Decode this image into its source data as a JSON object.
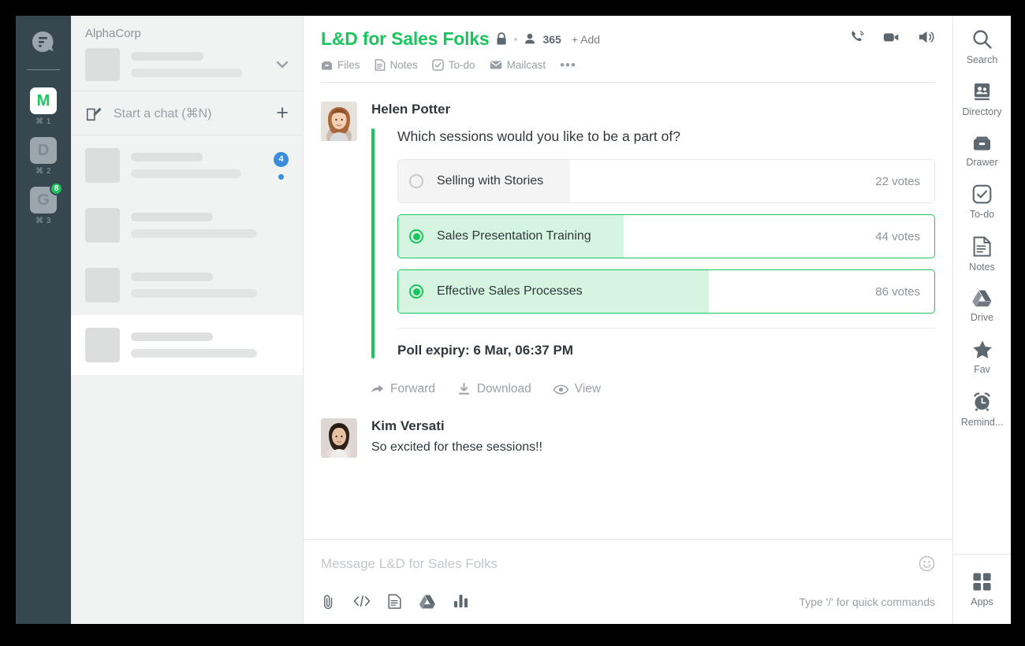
{
  "colors": {
    "accent_green": "#1ac55d",
    "rail_bg": "#36474f",
    "sidebar_bg": "#f1f2f2",
    "badge_blue": "#3a8ddb",
    "poll_fill_selected": "#d6f5e0",
    "poll_fill_unselected": "#f4f4f4",
    "text_dark": "#31383d",
    "text_muted": "#9aa0a5"
  },
  "rail": {
    "logo_icon": "flock-logo-icon",
    "orgs": [
      {
        "letter": "M",
        "shortcut": "⌘ 1",
        "active": true,
        "badge": ""
      },
      {
        "letter": "D",
        "shortcut": "⌘ 2",
        "active": false,
        "badge": ""
      },
      {
        "letter": "G",
        "shortcut": "⌘ 3",
        "active": false,
        "badge": "8"
      }
    ]
  },
  "sidebar": {
    "workspace_name": "AlphaCorp",
    "caret_icon": "chevron-down-icon",
    "start_chat_label": "Start a chat (⌘N)",
    "start_chat_icon": "compose-icon",
    "add_icon": "plus-icon",
    "chat_rows": [
      {
        "unread": "4",
        "has_dot": true,
        "highlight": false
      },
      {
        "unread": "",
        "has_dot": false,
        "highlight": false
      },
      {
        "unread": "",
        "has_dot": false,
        "highlight": false
      },
      {
        "unread": "",
        "has_dot": false,
        "highlight": true
      }
    ]
  },
  "header": {
    "channel_title": "L&D for Sales Folks",
    "lock_icon": "lock-icon",
    "members_icon": "person-icon",
    "member_count": "365",
    "add_label": "+ Add",
    "tabs": [
      {
        "label": "Files",
        "icon": "files-icon"
      },
      {
        "label": "Notes",
        "icon": "notes-icon"
      },
      {
        "label": "To-do",
        "icon": "todo-check-icon"
      },
      {
        "label": "Mailcast",
        "icon": "mail-icon"
      }
    ],
    "overflow_label": "•••",
    "actions": [
      {
        "name": "audio-call-icon"
      },
      {
        "name": "video-call-icon"
      },
      {
        "name": "announcement-icon"
      }
    ]
  },
  "messages": [
    {
      "author": "Helen Potter",
      "avatar": "helen-potter-avatar",
      "type": "poll",
      "poll": {
        "question": "Which sessions would you like to be a part of?",
        "options": [
          {
            "label": "Selling with Stories",
            "votes": "22 votes",
            "selected": false,
            "fill_pct": 32
          },
          {
            "label": "Sales Presentation Training",
            "votes": "44 votes",
            "selected": true,
            "fill_pct": 42
          },
          {
            "label": "Effective Sales Processes",
            "votes": "86 votes",
            "selected": true,
            "fill_pct": 58
          }
        ],
        "expiry": "Poll expiry: 6 Mar, 06:37 PM"
      },
      "actions": [
        {
          "label": "Forward",
          "icon": "forward-arrow-icon"
        },
        {
          "label": "Download",
          "icon": "download-icon"
        },
        {
          "label": "View",
          "icon": "eye-icon"
        }
      ]
    },
    {
      "author": "Kim Versati",
      "avatar": "kim-versati-avatar",
      "type": "text",
      "text": "So excited for these sessions!!"
    }
  ],
  "composer": {
    "placeholder": "Message L&D for Sales Folks",
    "emoji_icon": "smiley-icon",
    "hint": "Type '/' for quick commands",
    "icons": [
      {
        "name": "attachment-icon"
      },
      {
        "name": "code-snippet-icon"
      },
      {
        "name": "document-icon"
      },
      {
        "name": "google-drive-icon"
      },
      {
        "name": "poll-chart-icon"
      }
    ]
  },
  "rightbar": {
    "items": [
      {
        "label": "Search",
        "icon": "search-icon"
      },
      {
        "label": "Directory",
        "icon": "directory-icon"
      },
      {
        "label": "Drawer",
        "icon": "drawer-icon"
      },
      {
        "label": "To-do",
        "icon": "todo-check-icon"
      },
      {
        "label": "Notes",
        "icon": "notes-icon"
      },
      {
        "label": "Drive",
        "icon": "google-drive-icon"
      },
      {
        "label": "Fav",
        "icon": "star-icon"
      },
      {
        "label": "Remind...",
        "icon": "alarm-clock-icon"
      }
    ],
    "apps": {
      "label": "Apps",
      "icon": "apps-grid-icon"
    }
  },
  "chart_data": {
    "type": "bar",
    "title": "Which sessions would you like to be a part of?",
    "categories": [
      "Selling with Stories",
      "Sales Presentation Training",
      "Effective Sales Processes"
    ],
    "values": [
      22,
      44,
      86
    ],
    "value_labels": [
      "22 votes",
      "44 votes",
      "86 votes"
    ],
    "selected": [
      false,
      true,
      true
    ],
    "xlabel": "",
    "ylabel": "votes",
    "orientation": "horizontal",
    "legend": "none"
  }
}
